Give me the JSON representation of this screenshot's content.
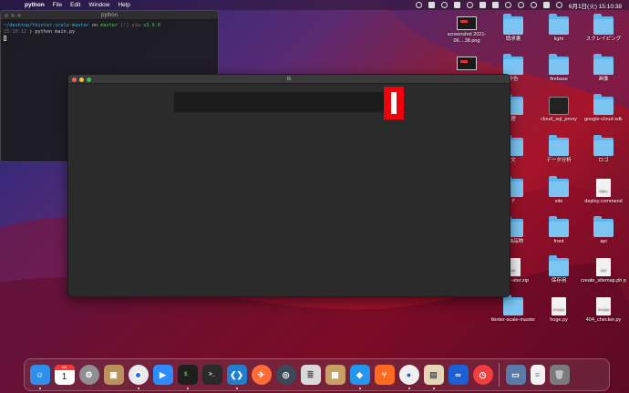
{
  "menubar": {
    "apple_glyph": "",
    "app_name": "python",
    "menus": [
      "File",
      "Edit",
      "Window",
      "Help"
    ],
    "clock": "6月1日(火) 15:10:38"
  },
  "terminal": {
    "title": "python",
    "path": "~/desktop/tkinter-scale-master",
    "on": "on",
    "branch": "master",
    "status": "[!] via",
    "version": "v3.9.0",
    "time": "15:10:12",
    "prompt": "❯",
    "command": "python main.py"
  },
  "tk_window": {
    "title": "tk",
    "scale_value_fraction": 1.0
  },
  "desktop": {
    "icons": [
      {
        "label": "screenshot 2021-06....38.png",
        "kind": "shot"
      },
      {
        "label": "請求書",
        "kind": "folder"
      },
      {
        "label": "light",
        "kind": "folder"
      },
      {
        "label": "スクレイピング",
        "kind": "folder"
      },
      {
        "label": "",
        "kind": "shot"
      },
      {
        "label": "中告",
        "kind": "folder"
      },
      {
        "label": "firebase",
        "kind": "folder"
      },
      {
        "label": "画像",
        "kind": "folder"
      },
      {
        "label": "理",
        "kind": "folder"
      },
      {
        "label": "cloud_sql_proxy",
        "kind": "term"
      },
      {
        "label": "google-cloud-sdk",
        "kind": "folder"
      },
      {
        "label": "文",
        "kind": "folder"
      },
      {
        "label": "データ分析",
        "kind": "folder"
      },
      {
        "label": "ロゴ",
        "kind": "folder"
      },
      {
        "label": "ド",
        "kind": "folder"
      },
      {
        "label": "site",
        "kind": "folder"
      },
      {
        "label": "deploy.command",
        "kind": "doc",
        "tag": "SHELL"
      },
      {
        "label": "式納品物",
        "kind": "folder"
      },
      {
        "label": "front",
        "kind": "folder"
      },
      {
        "label": "api",
        "kind": "folder"
      },
      {
        "label": "-scale-ster.zip",
        "kind": "doc",
        "tag": "ZIP"
      },
      {
        "label": "保存用",
        "kind": "folder"
      },
      {
        "label": "create_sitemap.ph p",
        "kind": "doc",
        "tag": "PHP"
      },
      {
        "label": "tkinter-scale-master",
        "kind": "folder"
      },
      {
        "label": "hoge.py",
        "kind": "doc",
        "tag": "PYTHON"
      },
      {
        "label": "404_checker.py",
        "kind": "doc",
        "tag": "PYTHON"
      }
    ]
  },
  "dock": {
    "calendar_month": "6月",
    "calendar_day": "1",
    "apps": [
      "finder-icon",
      "calendar-icon",
      "system-preferences-icon",
      "contacts-icon",
      "chrome-icon",
      "zoom-icon",
      "terminal-icon",
      "terminal-dark-icon",
      "vscode-icon",
      "postman-icon",
      "proxyman-icon",
      "sequel-icon",
      "archive-utility-icon",
      "docker-icon",
      "sourcetree-icon",
      "webcam-icon",
      "preview-icon",
      "infinity-icon",
      "clock-icon",
      "photos-icon",
      "document-icon",
      "trash-icon"
    ],
    "colors": {
      "finder": "#2f8fe8",
      "chrome": "#e8eaed",
      "zoom": "#2d8cff",
      "vscode": "#1f7fcc",
      "postman": "#ff6c37",
      "docker": "#2496ed",
      "sourcetree": "#ff6a20",
      "infinity": "#1a5fd6",
      "clock": "#f33c3c"
    }
  }
}
